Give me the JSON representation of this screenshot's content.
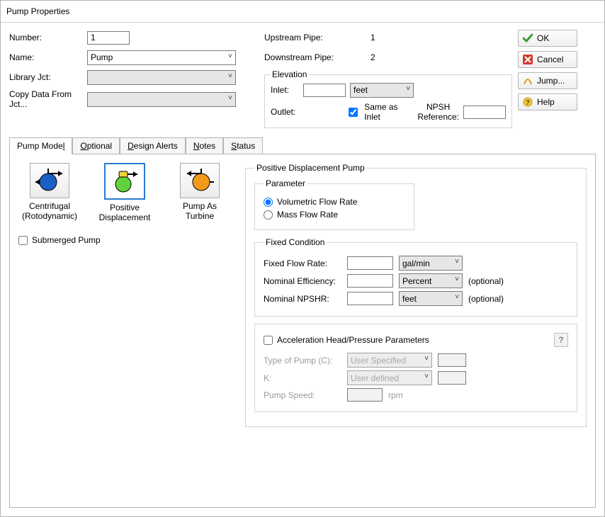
{
  "title": "Pump Properties",
  "basic": {
    "number_label": "Number:",
    "number_value": "1",
    "name_label": "Name:",
    "name_value": "Pump",
    "library_label": "Library Jct:",
    "copy_label": "Copy Data From Jct..."
  },
  "pipes": {
    "upstream_label": "Upstream Pipe:",
    "upstream_value": "1",
    "downstream_label": "Downstream Pipe:",
    "downstream_value": "2"
  },
  "elevation": {
    "legend": "Elevation",
    "inlet_label": "Inlet:",
    "inlet_value": "",
    "inlet_unit": "feet",
    "outlet_label": "Outlet:",
    "same_as_inlet_label": "Same as Inlet",
    "npsh_label": "NPSH Reference:",
    "npsh_value": ""
  },
  "buttons": {
    "ok": "OK",
    "cancel": "Cancel",
    "jump": "Jump...",
    "help": "Help"
  },
  "tabs": {
    "pump_model": "Pump Model",
    "pump_model_key": "l",
    "optional": "Optional",
    "optional_key": "O",
    "design_alerts": "Design Alerts",
    "design_alerts_key": "D",
    "notes": "Notes",
    "notes_key": "N",
    "status": "Status",
    "status_key": "S"
  },
  "pump_types": {
    "centrifugal": "Centrifugal (Rotodynamic)",
    "positive": "Positive Displacement",
    "pat": "Pump As Turbine"
  },
  "submerged_label": "Submerged Pump",
  "pdp": {
    "legend": "Positive Displacement Pump",
    "param_legend": "Parameter",
    "volumetric": "Volumetric Flow Rate",
    "mass": "Mass Flow Rate",
    "fixed_legend": "Fixed Condition",
    "flow_label": "Fixed Flow Rate:",
    "flow_value": "",
    "flow_unit": "gal/min",
    "eff_label": "Nominal Efficiency:",
    "eff_value": "",
    "eff_unit": "Percent",
    "npshr_label": "Nominal NPSHR:",
    "npshr_value": "",
    "npshr_unit": "feet",
    "optional_tag": "(optional)",
    "accel_label": "Acceleration Head/Pressure Parameters",
    "type_pump_label": "Type of Pump (C):",
    "type_pump_value": "User Specified",
    "k_label": "K:",
    "k_value": "User defined",
    "speed_label": "Pump Speed:",
    "speed_unit": "rpm"
  }
}
